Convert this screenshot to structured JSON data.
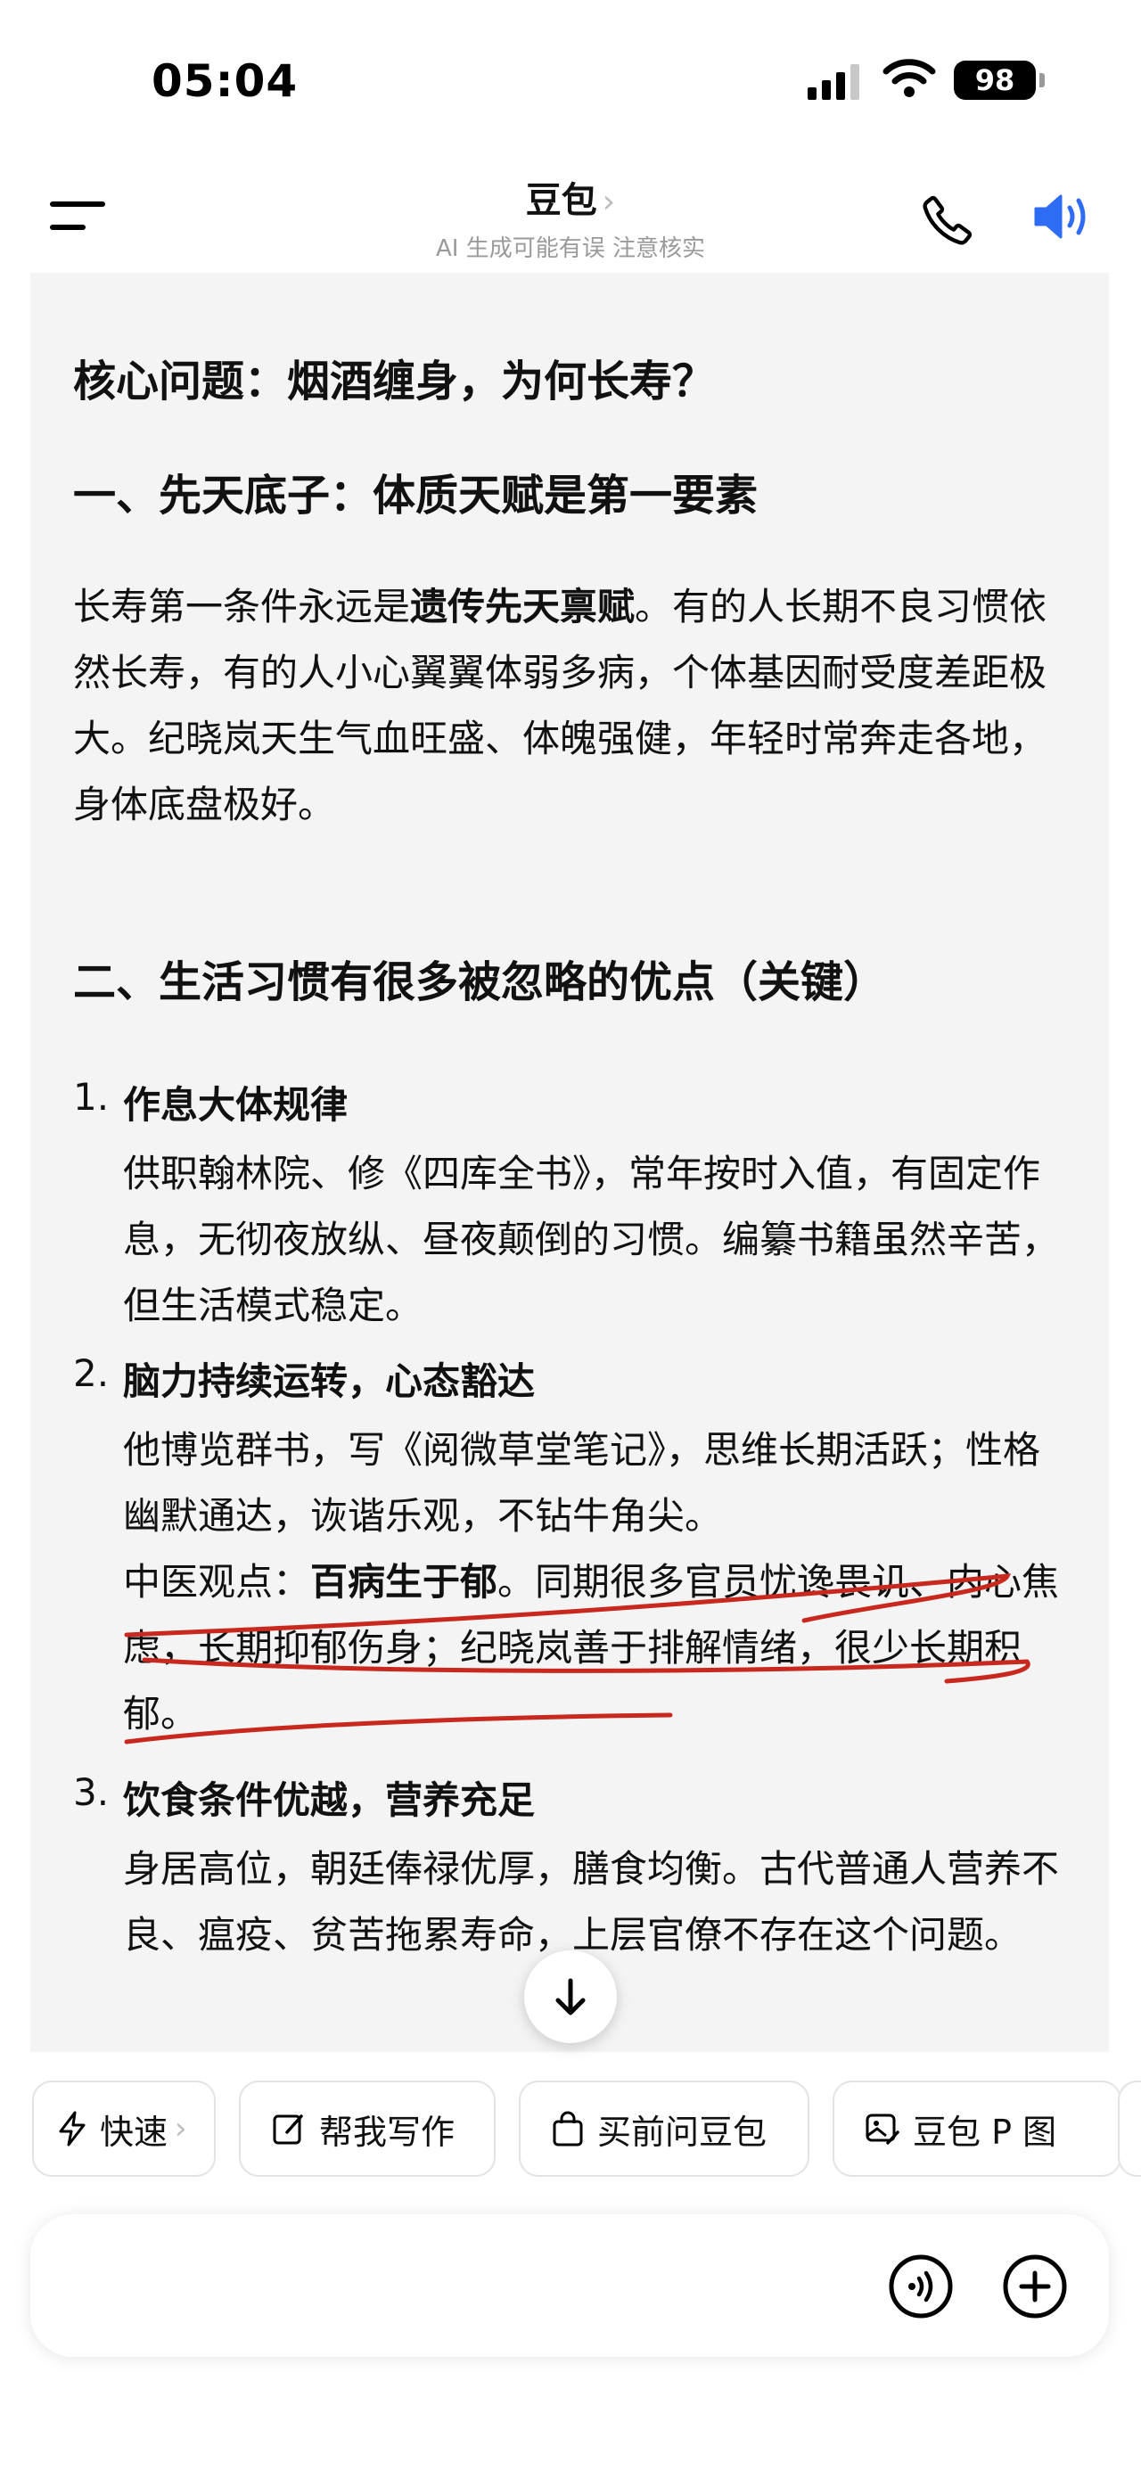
{
  "status_bar": {
    "time": "05:04",
    "battery": "98"
  },
  "header": {
    "title": "豆包",
    "title_chevron": "›",
    "subtitle": "AI 生成可能有误 注意核实"
  },
  "message": {
    "heading": "核心问题：烟酒缠身，为何长寿？",
    "section1_title": "一、先天底子：体质天赋是第一要素",
    "section1_para_prefix": "长寿第一条件永远是",
    "section1_para_bold": "遗传先天禀赋",
    "section1_para_rest": "。有的人长期不良习惯依然长寿，有的人小心翼翼体弱多病，个体基因耐受度差距极大。纪晓岚天生气血旺盛、体魄强健，年轻时常奔走各地，身体底盘极好。",
    "section2_title": "二、生活习惯有很多被忽略的优点（关键）",
    "items": [
      {
        "num": "1.",
        "title": "作息大体规律",
        "body": "供职翰林院、修《四库全书》，常年按时入值，有固定作息，无彻夜放纵、昼夜颠倒的习惯。编纂书籍虽然辛苦，但生活模式稳定。"
      },
      {
        "num": "2.",
        "title": "脑力持续运转，心态豁达",
        "body": "他博览群书，写《阅微草堂笔记》，思维长期活跃；性格幽默通达，诙谐乐观，不钻牛角尖。",
        "body2_prefix": "中医观点：",
        "body2_bold": "百病生于郁",
        "body2_rest": "。同期很多官员忧谗畏讥、内心焦虑，长期抑郁伤身；纪晓岚善于排解情绪，很少长期积郁。"
      },
      {
        "num": "3.",
        "title": "饮食条件优越，营养充足",
        "body": "身居高位，朝廷俸禄优厚，膳食均衡。古代普通人营养不良、瘟疫、贫苦拖累寿命，上层官僚不存在这个问题。"
      }
    ]
  },
  "chips": [
    {
      "label": "快速",
      "icon": "lightning-icon",
      "arrow": "›"
    },
    {
      "label": "帮我写作",
      "icon": "edit-icon"
    },
    {
      "label": "买前问豆包",
      "icon": "shopping-bag-icon"
    },
    {
      "label": "豆包 P 图",
      "icon": "image-edit-icon"
    }
  ],
  "input": {
    "placeholder": ""
  },
  "colors": {
    "accent": "#2f6cf6",
    "annotation": "#c8281e",
    "bubble": "#f4f4f5"
  }
}
